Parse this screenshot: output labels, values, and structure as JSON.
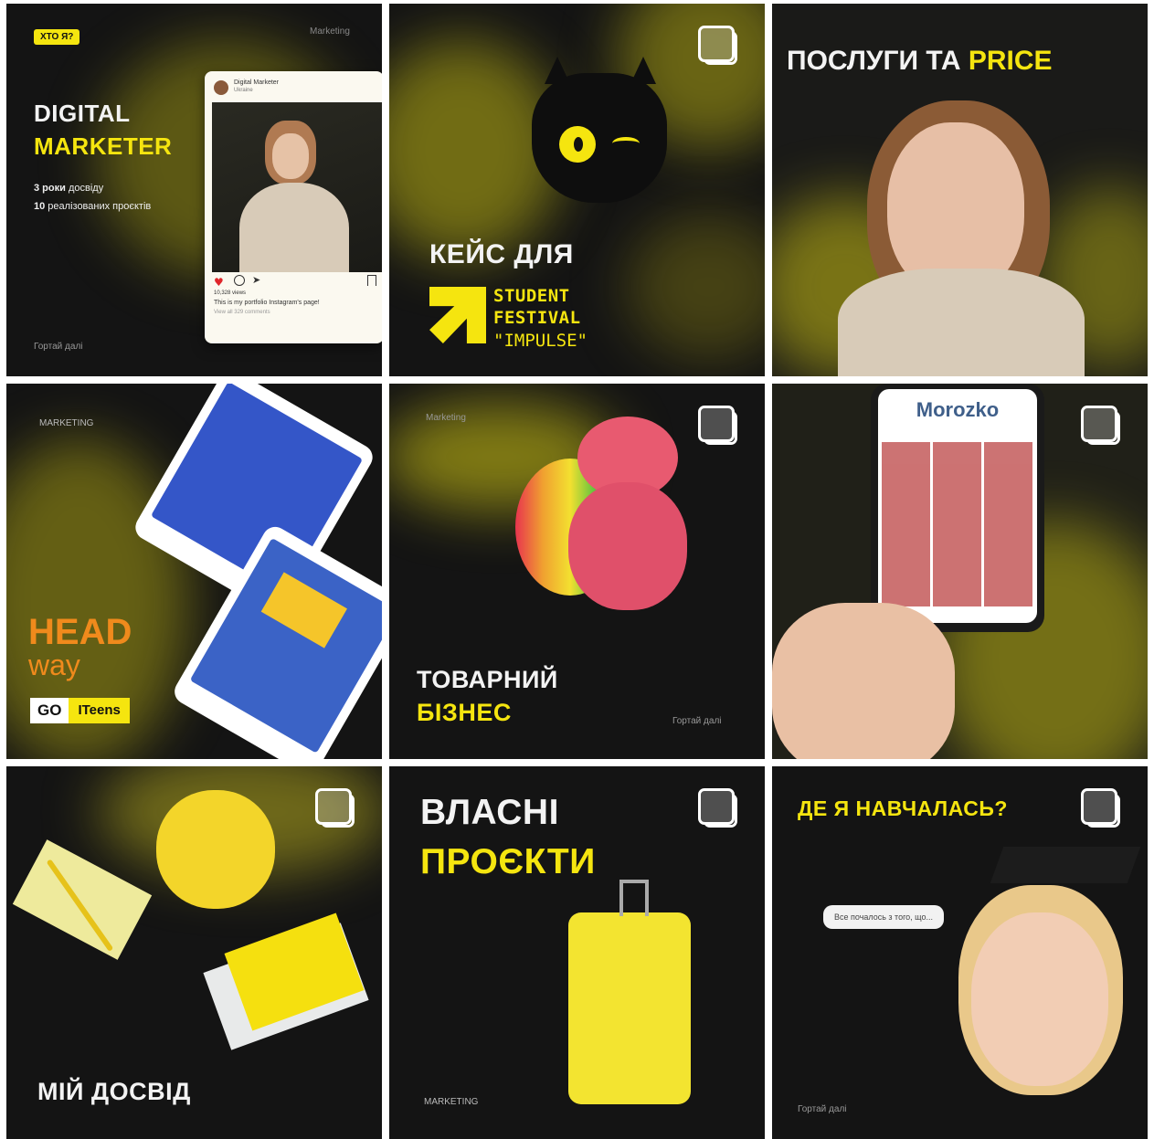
{
  "tiles": {
    "t1": {
      "badge": "ХТО Я?",
      "corner": "Marketing",
      "title_line1": "DIGITAL",
      "title_line2": "MARKETER",
      "stat1_bold": "3 роки",
      "stat1_rest": " досвіду",
      "stat2_bold": "10",
      "stat2_rest": " реалізованих проєктів",
      "footer": "Гортай далі",
      "post_name": "Digital Marketer",
      "post_location": "Ukraine",
      "post_views": "10,328 views",
      "post_caption": "This is my portfolio Instagram's page!",
      "post_comments": "View all 329 comments"
    },
    "t2": {
      "title": "КЕЙС ДЛЯ",
      "event_line1": "STUDENT",
      "event_line2": "FESTIVAL",
      "event_line3": "\"IMPULSE\""
    },
    "t3": {
      "title_white": "ПОСЛУГИ ТА ",
      "title_yellow": "PRICE"
    },
    "t4": {
      "corner": "MARKETING",
      "logo_head": "HEAD",
      "logo_way": "way",
      "goit_go": "GO",
      "goit_teens": "ITeens"
    },
    "t5": {
      "corner": "Marketing",
      "title_line1": "ТОВАРНИЙ",
      "title_line2": "БІЗНЕС",
      "footer": "Гортай далі"
    },
    "t6": {
      "app_title": "Morozko"
    },
    "t7": {
      "title": "МІЙ ДОСВІД"
    },
    "t8": {
      "title_line1": "ВЛАСНІ",
      "title_line2": "ПРОЄКТИ",
      "corner": "MARKETING"
    },
    "t9": {
      "title": "ДЕ Я НАВЧАЛАСЬ?",
      "bubble": "Все почалось з того, що...",
      "footer": "Гортай далі"
    }
  },
  "colors": {
    "accent": "#f5e50f",
    "background": "#141414"
  },
  "icons": [
    "carousel-icon",
    "heart-icon",
    "comment-icon",
    "share-icon",
    "bookmark-icon",
    "arrow-logo-icon"
  ]
}
